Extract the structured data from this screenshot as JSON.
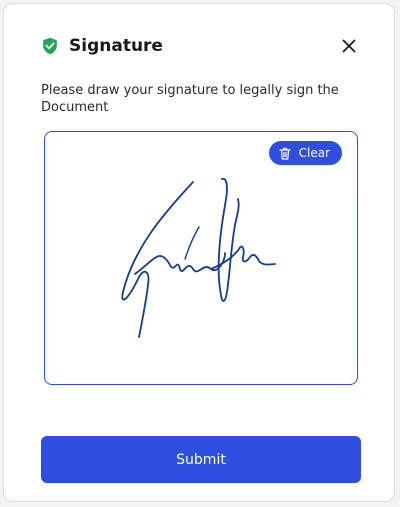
{
  "dialog": {
    "title": "Signature",
    "title_icon": "shield-check-icon",
    "close_icon": "close-icon",
    "instructions": "Please draw your signature to legally sign the Document",
    "clear_label": "Clear",
    "clear_icon": "trash-icon",
    "submit_label": "Submit"
  },
  "colors": {
    "accent": "#2f4fe0",
    "shield": "#22a45a",
    "signature_ink": "#163a8c"
  }
}
